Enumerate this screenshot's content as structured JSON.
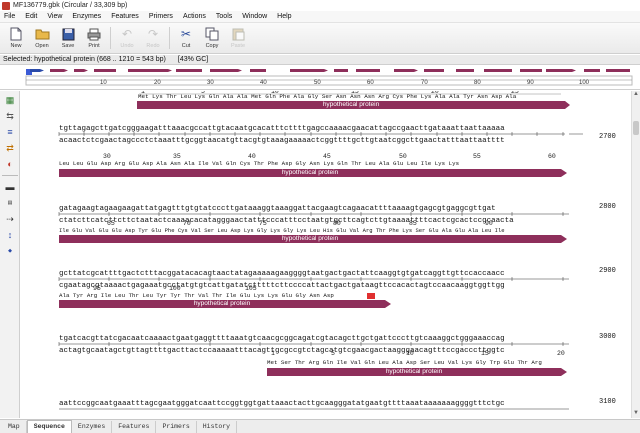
{
  "window": {
    "title": "MF136779.gbk (Circular / 33,309 bp)"
  },
  "menu": [
    "File",
    "Edit",
    "View",
    "Enzymes",
    "Features",
    "Primers",
    "Actions",
    "Tools",
    "Window",
    "Help"
  ],
  "toolbar": [
    {
      "label": "New",
      "icon": "new-document-icon",
      "enabled": true
    },
    {
      "label": "Open",
      "icon": "folder-icon",
      "enabled": true
    },
    {
      "label": "Save",
      "icon": "floppy-disk-icon",
      "enabled": true
    },
    {
      "label": "Print",
      "icon": "printer-icon",
      "enabled": true
    },
    {
      "label": "Undo",
      "icon": "undo-icon",
      "enabled": false
    },
    {
      "label": "Redo",
      "icon": "redo-icon",
      "enabled": false
    },
    {
      "label": "Cut",
      "icon": "scissors-icon",
      "enabled": true
    },
    {
      "label": "Copy",
      "icon": "copy-icon",
      "enabled": true
    },
    {
      "label": "Paste",
      "icon": "paste-icon",
      "enabled": false
    }
  ],
  "selection": {
    "text": "Selected:  hypothetical protein  (668 .. 1210 = 543 bp)",
    "gc": "[43% GC]"
  },
  "map_ruler": [
    "10",
    "20",
    "30",
    "40",
    "50",
    "60",
    "70",
    "80",
    "90",
    "100"
  ],
  "tabs": [
    "Map",
    "Sequence",
    "Enzymes",
    "Features",
    "Primers",
    "History"
  ],
  "active_tab": "Sequence",
  "colors": {
    "feature": "#8e2f5b",
    "feature_dark": "#6b1f44",
    "highlight": "#e03030"
  },
  "sequence": {
    "top_partial": {
      "aa": "Met Lys Thr Leu Lys Gln Ala Ala Met Gln Phe Ala Gly Ser Asn Asn Asn Arg Cys Phe Lys Ala Ala Tyr Asn Asp Ala",
      "idx": [
        "1",
        "5",
        "10",
        "15",
        "20",
        "25"
      ],
      "feature": "hypothetical protein"
    },
    "blocks": [
      {
        "pos": "2700",
        "top": "tgttagagcttgatcgggaagatttaaacgccattgtacaatgcacatttcttttgagccaaaacgaacattagccgaacttgataaattaattaaaaa",
        "bottom": "acaactctcgaactagccctctaaatttgcggtaacatgttacgtgtaaagaaaaactcggttttgcttgtaatcggcttgaactatttaattaatttt",
        "idx": [
          "30",
          "35",
          "40",
          "45",
          "50",
          "55",
          "60"
        ],
        "aa": "Leu Leu Glu Asp Arg Glu Asp Ala Asn Ala Ile Val Gln Cys Thr Phe Asp Gly Asn Lys Gln Thr Leu Ala Glu Leu Ile Lys Lys",
        "feature": "hypothetical protein"
      },
      {
        "pos": "2800",
        "top": "gatagaagtagaagaagattatgagtttgtgtatcccttgataaaggtaaaggattacgaagtcagaacattttaaaagtgagcgtgaggcgttgat",
        "bottom": "ctatcttcatcttcttctaatactcaaaacacatagggaactatttcccatttcctaatgtgcttcagtcttgtaaaattttcactcgcactccgcaacta",
        "idx": [
          "65",
          "70",
          "75",
          "80",
          "85",
          "90"
        ],
        "aa": "Ile Glu Val Glu Glu Asp Tyr Glu Phe Cys Val Ser Leu Asp Lys Gly Lys Gly Lys Leu His Glu Val Arg Thr Phe Lys Ser Glu Ala Glu Ala Leu Ile",
        "feature": "hypothetical protein"
      },
      {
        "pos": "2900",
        "top": "gcttatcgcattttgactctttacggatacacagtaactatagaaaaagaaggggtaatgactgactattcaaggtgtgatcaggttgttccaccaacc",
        "bottom": "cgaatagcgtaaaactgagaaatgcctatgtgtcattgatatctttttcttccccattactgactgataagttccacactagtccaacaaggtggttgg",
        "idx": [
          "95",
          "100",
          "105"
        ],
        "aa": "Ala Tyr Arg Ile Leu Thr Leu Tyr Tyr Thr Val Thr Ile Glu Lys Lys Glu Gly Asn Asp",
        "feature": "hypothetical protein"
      },
      {
        "pos": "3000",
        "top": "tgatcacgttatcgacaatcaaaactgaatgaggttttaaatgtcaacgcggcagatcgtacagcttgctgattcccttgtcaaaggctgggaaaccag",
        "bottom": "actagtgcaatagctgttagttttgacttactccaaaaatttacagttgcgccgtctagcatgtcgaacgactaagggaacagtttccgacccttggtc",
        "idx": [
          "1",
          "5",
          "10",
          "15",
          "20"
        ],
        "aa": "Met Ser Thr Arg Gln Ile Val Gln Leu Ala Asp Ser Leu Val Lys Gly Trp Glu Thr Arg",
        "feature": "hypothetical protein"
      },
      {
        "pos": "3100",
        "top": "aattccggcaatgaaatttagcgaatgggatcaattccggtggtgattaaactacttgcaagggatatgaatgttttaaataaaaaaaggggtttctgc"
      }
    ]
  }
}
